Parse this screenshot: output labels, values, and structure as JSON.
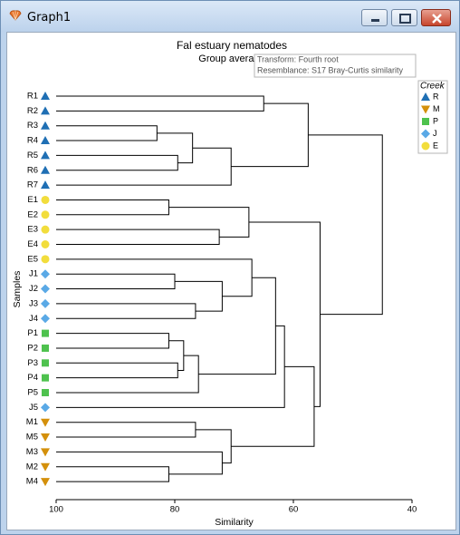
{
  "window": {
    "title": "Graph1",
    "buttons": [
      "minimize",
      "maximize",
      "close"
    ],
    "icons": {
      "app": "shell-icon",
      "minimize": "minimize-icon",
      "maximize": "maximize-icon",
      "close": "close-icon"
    }
  },
  "chart_data": {
    "type": "dendrogram",
    "title": "Fal estuary nematodes",
    "subtitle": "Group average",
    "info_lines": [
      "Transform: Fourth root",
      "Resemblance: S17 Bray-Curtis similarity"
    ],
    "xlabel": "Similarity",
    "ylabel": "Samples",
    "xlim": [
      100,
      40
    ],
    "xticks": [
      100,
      80,
      60,
      40
    ],
    "legend": {
      "title": "Creek",
      "placement": "top-right",
      "entries": [
        {
          "label": "R",
          "shape": "triangle-up",
          "color": "#1f6fb4"
        },
        {
          "label": "M",
          "shape": "triangle-down",
          "color": "#d4900b"
        },
        {
          "label": "P",
          "shape": "square",
          "color": "#4ec24e"
        },
        {
          "label": "J",
          "shape": "diamond",
          "color": "#5aa9e6"
        },
        {
          "label": "E",
          "shape": "circle",
          "color": "#f2dd3c"
        }
      ]
    },
    "samples": [
      {
        "label": "R1",
        "group": "R"
      },
      {
        "label": "R2",
        "group": "R"
      },
      {
        "label": "R3",
        "group": "R"
      },
      {
        "label": "R4",
        "group": "R"
      },
      {
        "label": "R5",
        "group": "R"
      },
      {
        "label": "R6",
        "group": "R"
      },
      {
        "label": "R7",
        "group": "R"
      },
      {
        "label": "E1",
        "group": "E"
      },
      {
        "label": "E2",
        "group": "E"
      },
      {
        "label": "E3",
        "group": "E"
      },
      {
        "label": "E4",
        "group": "E"
      },
      {
        "label": "E5",
        "group": "E"
      },
      {
        "label": "J1",
        "group": "J"
      },
      {
        "label": "J2",
        "group": "J"
      },
      {
        "label": "J3",
        "group": "J"
      },
      {
        "label": "J4",
        "group": "J"
      },
      {
        "label": "P1",
        "group": "P"
      },
      {
        "label": "P2",
        "group": "P"
      },
      {
        "label": "P3",
        "group": "P"
      },
      {
        "label": "P4",
        "group": "P"
      },
      {
        "label": "P5",
        "group": "P"
      },
      {
        "label": "J5",
        "group": "J"
      },
      {
        "label": "M1",
        "group": "M"
      },
      {
        "label": "M5",
        "group": "M"
      },
      {
        "label": "M3",
        "group": "M"
      },
      {
        "label": "M2",
        "group": "M"
      },
      {
        "label": "M4",
        "group": "M"
      }
    ],
    "merges": [
      {
        "a": "R1",
        "b": "R2",
        "similarity": 65
      },
      {
        "a": "R3",
        "b": "R4",
        "similarity": 83
      },
      {
        "a": "R5",
        "b": "R6",
        "similarity": 79.5
      },
      {
        "a": "R3-R4",
        "b": "R5-R6",
        "similarity": 77
      },
      {
        "a": "R3-R6",
        "b": "R7",
        "similarity": 70.5
      },
      {
        "a": "R1-R2",
        "b": "R3-R7",
        "similarity": 57.5
      },
      {
        "a": "E1",
        "b": "E2",
        "similarity": 81
      },
      {
        "a": "E3",
        "b": "E4",
        "similarity": 72.5
      },
      {
        "a": "E1-E2",
        "b": "E3-E4",
        "similarity": 67.5
      },
      {
        "a": "J1",
        "b": "J2",
        "similarity": 80
      },
      {
        "a": "J3",
        "b": "J4",
        "similarity": 76.5
      },
      {
        "a": "J1-J2",
        "b": "J3-J4",
        "similarity": 72
      },
      {
        "a": "E5",
        "b": "J1-J4",
        "similarity": 67
      },
      {
        "a": "P1",
        "b": "P2",
        "similarity": 81
      },
      {
        "a": "P3",
        "b": "P4",
        "similarity": 79.5
      },
      {
        "a": "P1-P2",
        "b": "P3-P4",
        "similarity": 78.5
      },
      {
        "a": "P1-P4",
        "b": "P5",
        "similarity": 76
      },
      {
        "a": "E5-J4",
        "b": "P1-P5",
        "similarity": 63
      },
      {
        "a": "E5-P5",
        "b": "J5",
        "similarity": 61.5
      },
      {
        "a": "M1",
        "b": "M5",
        "similarity": 76.5
      },
      {
        "a": "M2",
        "b": "M4",
        "similarity": 81
      },
      {
        "a": "M3",
        "b": "M2-M4",
        "similarity": 72
      },
      {
        "a": "M1-M5",
        "b": "M3-M4",
        "similarity": 70.5
      },
      {
        "a": "E5-J5",
        "b": "M1-M4",
        "similarity": 56.5
      },
      {
        "a": "E1-E4",
        "b": "E5-M4",
        "similarity": 55.5
      },
      {
        "a": "R1-R7",
        "b": "E1-M4",
        "similarity": 45
      }
    ]
  }
}
